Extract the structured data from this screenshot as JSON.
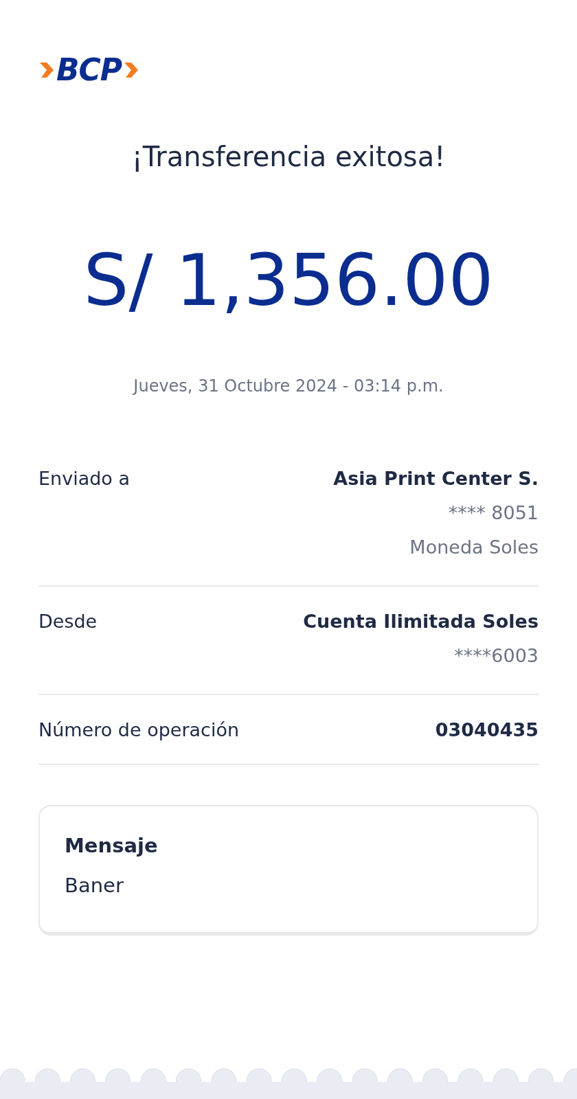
{
  "logo": {
    "text": "BCP"
  },
  "title": "¡Transferencia exitosa!",
  "amount": "S/ 1,356.00",
  "datetime": "Jueves, 31 Octubre 2024 - 03:14 p.m.",
  "details": [
    {
      "label": "Enviado a",
      "values": [
        {
          "text": "Asia Print Center S.",
          "kind": "primary"
        },
        {
          "text": "**** 8051",
          "kind": "secondary"
        },
        {
          "text": "Moneda Soles",
          "kind": "secondary"
        }
      ]
    },
    {
      "label": "Desde",
      "values": [
        {
          "text": "Cuenta Ilimitada Soles",
          "kind": "primary"
        },
        {
          "text": "****6003",
          "kind": "secondary"
        }
      ]
    },
    {
      "label": "Número de operación",
      "values": [
        {
          "text": "03040435",
          "kind": "strong"
        }
      ]
    }
  ],
  "message": {
    "title": "Mensaje",
    "text": "Baner"
  }
}
